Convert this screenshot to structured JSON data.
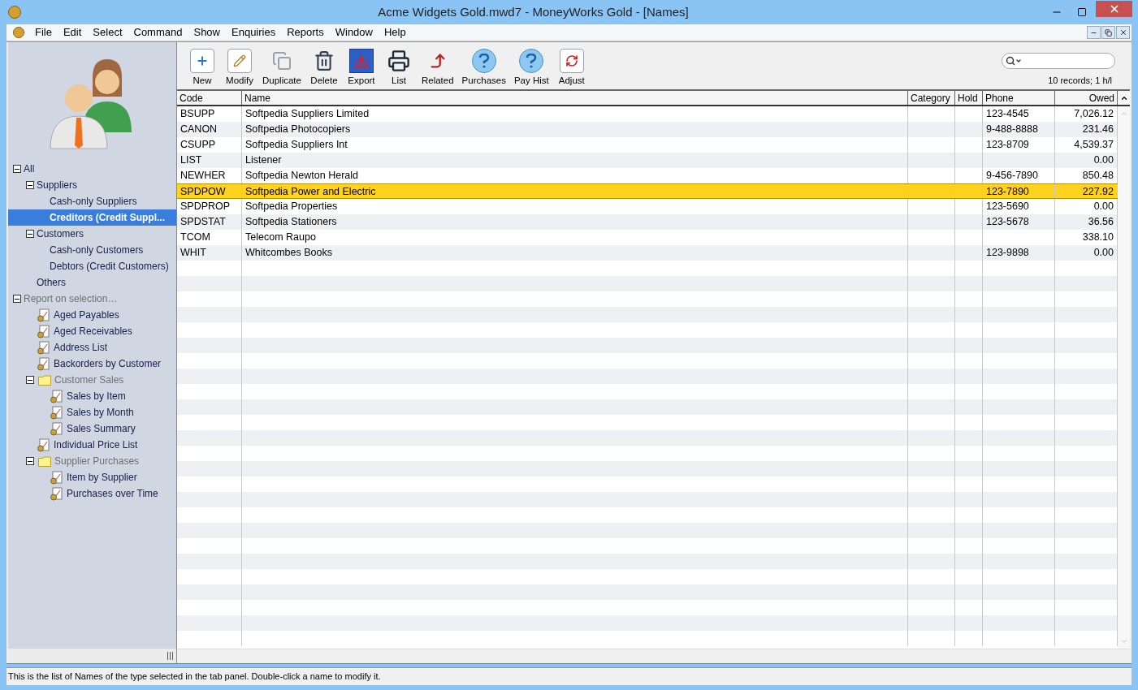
{
  "window": {
    "title": "Acme Widgets Gold.mwd7 - MoneyWorks Gold - [Names]"
  },
  "menu": [
    "File",
    "Edit",
    "Select",
    "Command",
    "Show",
    "Enquiries",
    "Reports",
    "Window",
    "Help"
  ],
  "toolbar": [
    {
      "label": "New",
      "kind": "new"
    },
    {
      "label": "Modify",
      "kind": "modify"
    },
    {
      "label": "Duplicate",
      "kind": "duplicate"
    },
    {
      "label": "Delete",
      "kind": "delete"
    },
    {
      "label": "Export",
      "kind": "export"
    },
    {
      "label": "List",
      "kind": "list"
    },
    {
      "label": "Related",
      "kind": "related"
    },
    {
      "label": "Purchases",
      "kind": "help"
    },
    {
      "label": "Pay Hist",
      "kind": "help"
    },
    {
      "label": "Adjust",
      "kind": "adjust"
    }
  ],
  "record_count": "10 records; 1 h/l",
  "sidebar": {
    "tree": [
      {
        "label": "All",
        "kind": "group",
        "expanded": true,
        "selected": false,
        "children": [
          {
            "label": "Suppliers",
            "kind": "group",
            "expanded": true,
            "selected": false,
            "children": [
              {
                "label": "Cash-only Suppliers",
                "kind": "filter",
                "selected": false
              },
              {
                "label": "Creditors (Credit Suppl...",
                "kind": "filter",
                "selected": true
              }
            ]
          },
          {
            "label": "Customers",
            "kind": "group",
            "expanded": true,
            "selected": false,
            "children": [
              {
                "label": "Cash-only Customers",
                "kind": "filter",
                "selected": false
              },
              {
                "label": "Debtors (Credit Customers)",
                "kind": "filter",
                "selected": false
              }
            ]
          },
          {
            "label": "Others",
            "kind": "filter",
            "selected": false
          }
        ]
      },
      {
        "label": "Report on selection…",
        "kind": "heading",
        "expanded": true,
        "selected": false,
        "children": [
          {
            "label": "Aged Payables",
            "kind": "report",
            "selected": false
          },
          {
            "label": "Aged Receivables",
            "kind": "report",
            "selected": false
          },
          {
            "label": "Address List",
            "kind": "report",
            "selected": false
          },
          {
            "label": "Backorders by Customer",
            "kind": "report",
            "selected": false
          },
          {
            "label": "Customer Sales",
            "kind": "folder",
            "expanded": true,
            "selected": false,
            "children": [
              {
                "label": "Sales by Item",
                "kind": "report",
                "selected": false
              },
              {
                "label": "Sales by Month",
                "kind": "report",
                "selected": false
              },
              {
                "label": "Sales Summary",
                "kind": "report",
                "selected": false
              }
            ]
          },
          {
            "label": "Individual Price List",
            "kind": "report",
            "selected": false
          },
          {
            "label": "Supplier Purchases",
            "kind": "folder",
            "expanded": true,
            "selected": false,
            "children": [
              {
                "label": "Item by Supplier",
                "kind": "report",
                "selected": false
              },
              {
                "label": "Purchases over Time",
                "kind": "report",
                "selected": false
              }
            ]
          }
        ]
      }
    ]
  },
  "table": {
    "columns": [
      "Code",
      "Name",
      "Category",
      "Hold",
      "Phone",
      "Owed"
    ],
    "rows": [
      {
        "cells": [
          "BSUPP",
          "Softpedia Suppliers Limited",
          "",
          "",
          "123-4545",
          "7,026.12"
        ],
        "selected": false
      },
      {
        "cells": [
          "CANON",
          "Softpedia Photocopiers",
          "",
          "",
          "9-488-8888",
          "231.46"
        ],
        "selected": false
      },
      {
        "cells": [
          "CSUPP",
          "Softpedia Suppliers Int",
          "",
          "",
          "123-8709",
          "4,539.37"
        ],
        "selected": false
      },
      {
        "cells": [
          "LIST",
          "Listener",
          "",
          "",
          "",
          "0.00"
        ],
        "selected": false
      },
      {
        "cells": [
          "NEWHER",
          "Softpedia Newton Herald",
          "",
          "",
          "9-456-7890",
          "850.48"
        ],
        "selected": false
      },
      {
        "cells": [
          "SPDPOW",
          "Softpedia Power and Electric",
          "",
          "",
          "123-7890",
          "227.92"
        ],
        "selected": true
      },
      {
        "cells": [
          "SPDPROP",
          "Softpedia Properties",
          "",
          "",
          "123-5690",
          "0.00"
        ],
        "selected": false
      },
      {
        "cells": [
          "SPDSTAT",
          "Softpedia Stationers",
          "",
          "",
          "123-5678",
          "36.56"
        ],
        "selected": false
      },
      {
        "cells": [
          "TCOM",
          "Telecom Raupo",
          "",
          "",
          "",
          "338.10"
        ],
        "selected": false
      },
      {
        "cells": [
          "WHIT",
          "Whitcombes Books",
          "",
          "",
          "123-9898",
          "0.00"
        ],
        "selected": false
      }
    ]
  },
  "status_bar": "This is the list of Names of the type selected in the tab panel. Double-click a name to modify it."
}
